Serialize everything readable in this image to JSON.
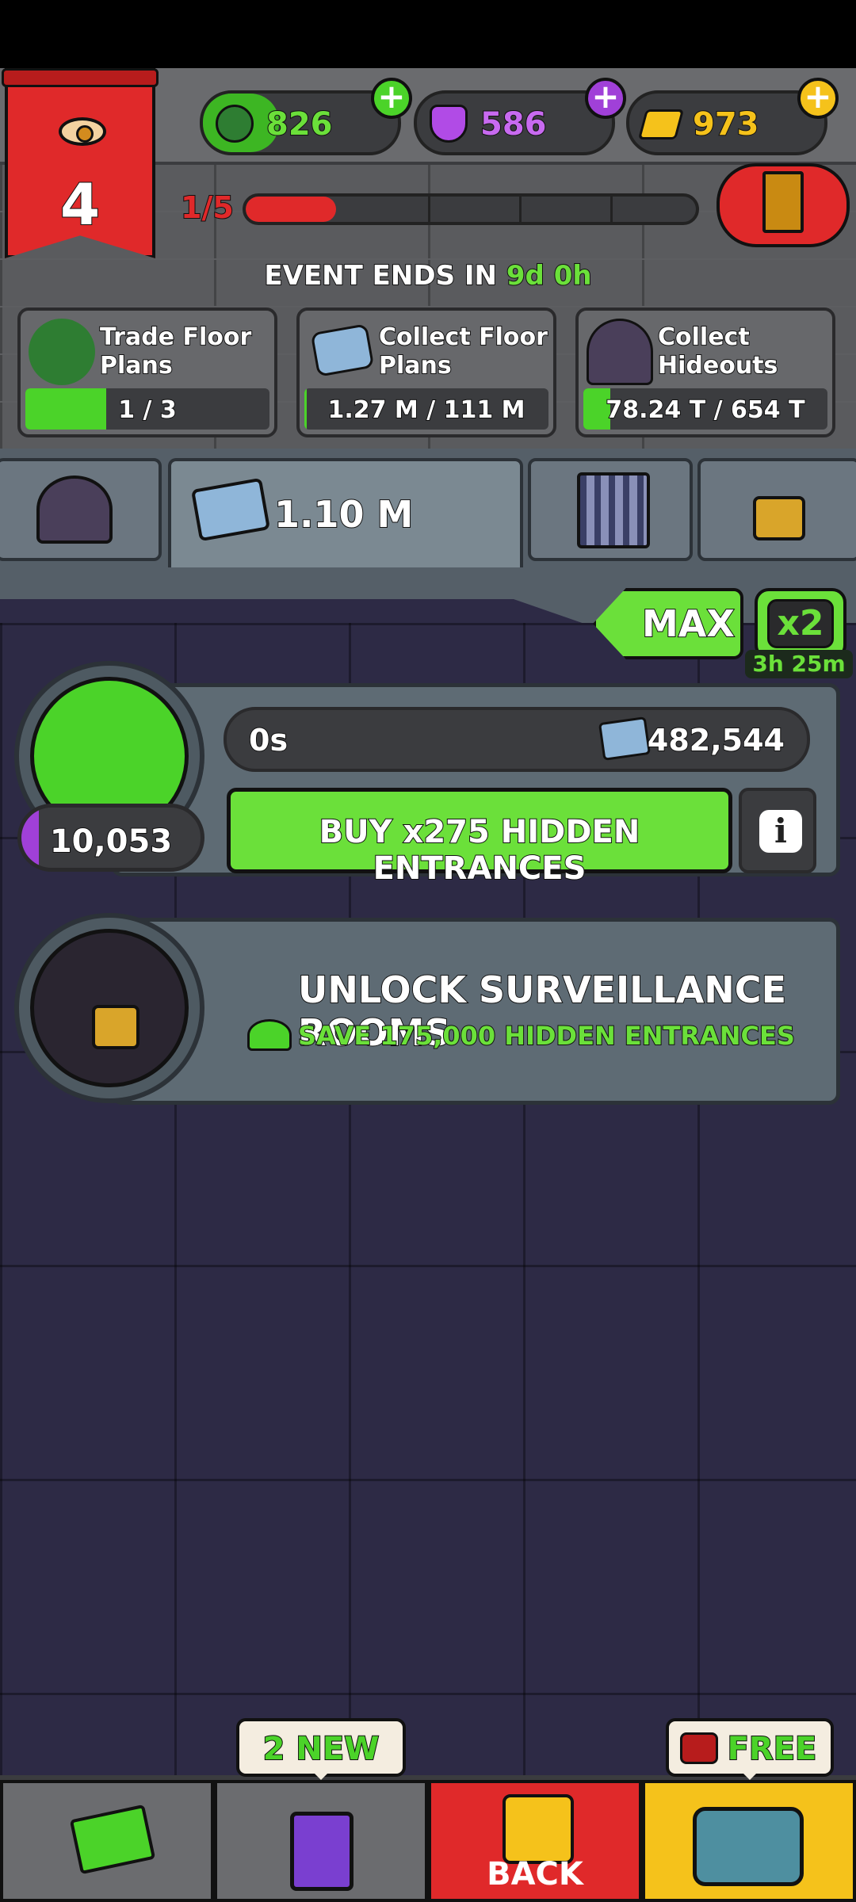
{
  "header": {
    "level_number": "4",
    "currencies": [
      {
        "name": "villains",
        "value": "826",
        "color": "#4bd329",
        "icon": "goblin-head-icon"
      },
      {
        "name": "potion",
        "value": "586",
        "color": "#b14be6",
        "icon": "potion-icon"
      },
      {
        "name": "gold",
        "value": "973",
        "color": "#f5c21b",
        "icon": "gold-bar-icon"
      }
    ],
    "level_progress_label": "1/5",
    "level_progress_fraction": 0.2
  },
  "event": {
    "prefix": "EVENT ENDS IN ",
    "days": "9d",
    "hours": "0h",
    "missions": [
      {
        "title_line1": "Trade Floor",
        "title_line2": "Plans",
        "progress": "1 / 3",
        "fraction": 0.33
      },
      {
        "title_line1": "Collect Floor",
        "title_line2": "Plans",
        "progress": "1.27 M / 111 M",
        "fraction": 0.01
      },
      {
        "title_line1": "Collect",
        "title_line2": "Hideouts",
        "progress": "78.24 T / 654 T",
        "fraction": 0.11
      }
    ]
  },
  "tabs": {
    "active_value": "1.10 M"
  },
  "boost": {
    "max_label": "MAX",
    "multiplier_label": "x2",
    "timer": "3h 25m"
  },
  "producer": {
    "time": "0s",
    "output": "482,544",
    "owned": "10,053",
    "buy_label": "BUY x275 HIDDEN ENTRANCES",
    "info_label": "i"
  },
  "locked": {
    "title": "UNLOCK SURVEILLANCE ROOMS",
    "requirement": "SAVE 175,000 HIDDEN ENTRANCES"
  },
  "nav": {
    "cards_badge": "2 NEW",
    "back_label": "BACK",
    "chest_badge": "FREE"
  },
  "colors": {
    "accent_green": "#6be03a",
    "accent_red": "#e0292a",
    "panel_bg": "#2d2a45"
  }
}
